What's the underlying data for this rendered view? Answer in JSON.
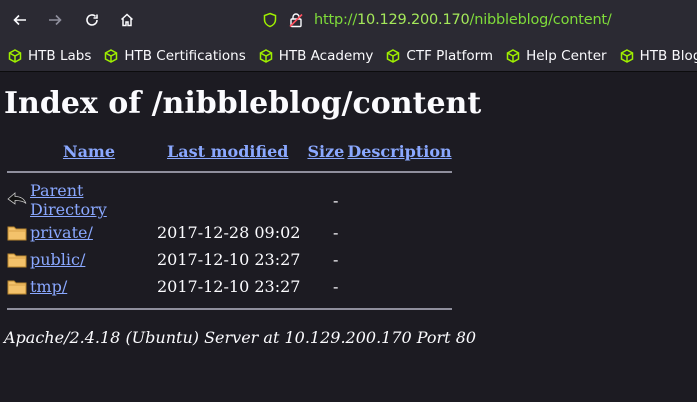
{
  "browser": {
    "url_scheme": "http://",
    "url_host": "10.129.200.170",
    "url_path": "/nibbleblog/content/",
    "icons": [
      "arrow-left-icon",
      "arrow-right-icon",
      "reload-icon",
      "home-icon",
      "shield-icon",
      "insecure-lock-icon"
    ]
  },
  "bookmarks": [
    {
      "label": "HTB Labs",
      "icon": "htb-cube-icon"
    },
    {
      "label": "HTB Certifications",
      "icon": "htb-cube-icon"
    },
    {
      "label": "HTB Academy",
      "icon": "htb-cube-icon"
    },
    {
      "label": "CTF Platform",
      "icon": "htb-cube-icon"
    },
    {
      "label": "Help Center",
      "icon": "htb-cube-icon"
    },
    {
      "label": "HTB Blog",
      "icon": "htb-cube-icon"
    }
  ],
  "page": {
    "title": "Index of /nibbleblog/content",
    "columns": {
      "name": "Name",
      "modified": "Last modified",
      "size": "Size",
      "description": "Description"
    },
    "parent": {
      "label": "Parent Directory",
      "size": "-",
      "icon": "back-arrow-icon"
    },
    "rows": [
      {
        "name": "private/",
        "modified": "2017-12-28 09:02",
        "size": "-",
        "icon": "folder-icon"
      },
      {
        "name": "public/",
        "modified": "2017-12-10 23:27",
        "size": "-",
        "icon": "folder-icon"
      },
      {
        "name": "tmp/",
        "modified": "2017-12-10 23:27",
        "size": "-",
        "icon": "folder-icon"
      }
    ],
    "footer": "Apache/2.4.18 (Ubuntu) Server at 10.129.200.170 Port 80"
  },
  "colors": {
    "accent_link": "#8aa8ff",
    "url_green": "#7fdc3a",
    "htb_green": "#9fef00"
  }
}
